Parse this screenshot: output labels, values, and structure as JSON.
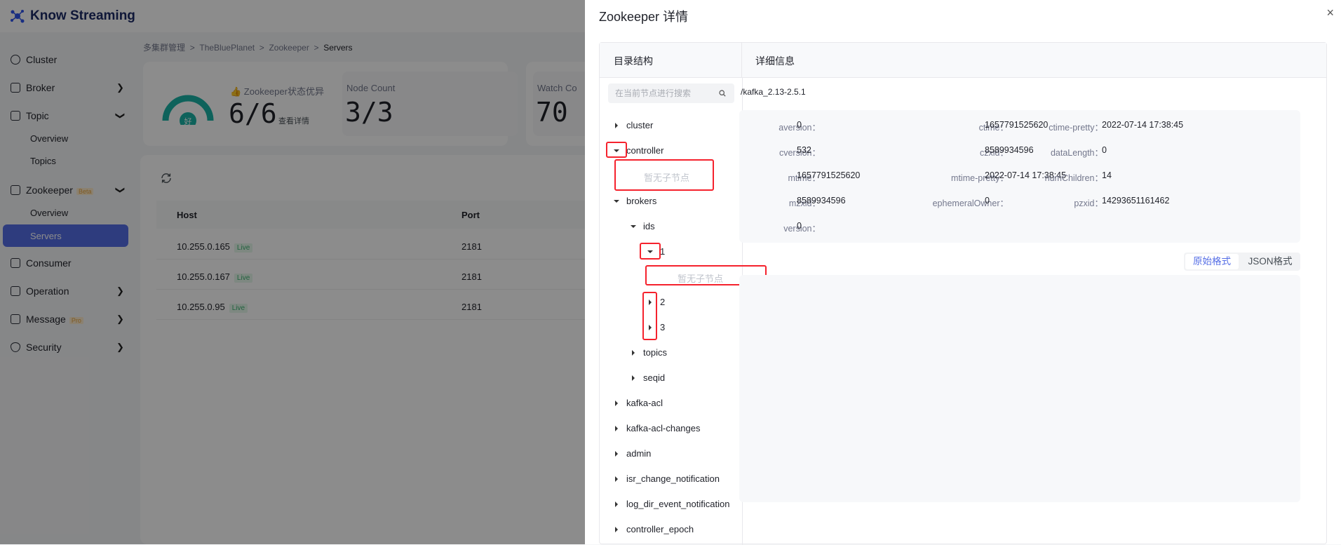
{
  "app": {
    "title": "Know Streaming"
  },
  "sidebar": {
    "items": [
      {
        "label": "Cluster"
      },
      {
        "label": "Broker"
      },
      {
        "label": "Topic"
      },
      {
        "label": "Overview"
      },
      {
        "label": "Topics"
      },
      {
        "label": "Zookeeper",
        "badge": "Beta"
      },
      {
        "label": "Overview"
      },
      {
        "label": "Servers"
      },
      {
        "label": "Consumer"
      },
      {
        "label": "Operation"
      },
      {
        "label": "Message",
        "badge": "Pro"
      },
      {
        "label": "Security"
      }
    ]
  },
  "breadcrumb": {
    "items": [
      "多集群管理",
      "TheBluePlanet",
      "Zookeeper"
    ],
    "sep": ">",
    "current": "Servers"
  },
  "stats": {
    "gauge_label": "好",
    "status_label": "👍 Zookeeper状态优异",
    "status_value": "6/6",
    "status_link": "查看详情",
    "node_count_label": "Node Count",
    "node_count_value": "3/3",
    "watch_label": "Watch Co",
    "watch_value": "70"
  },
  "table": {
    "columns": [
      "Host",
      "Port"
    ],
    "rows": [
      {
        "host": "10.255.0.165",
        "status": "Live",
        "port": "2181"
      },
      {
        "host": "10.255.0.167",
        "status": "Live",
        "port": "2181"
      },
      {
        "host": "10.255.0.95",
        "status": "Live",
        "port": "2181"
      }
    ]
  },
  "drawer": {
    "title": "Zookeeper 详情",
    "close": "×",
    "tree_header": "目录结构",
    "detail_header": "详细信息",
    "search_placeholder": "在当前节点进行搜索",
    "tree": {
      "cluster": "cluster",
      "controller": "controller",
      "empty1": "暂无子节点",
      "brokers": "brokers",
      "ids": "ids",
      "id1": "1",
      "empty2": "暂无子节点",
      "id2": "2",
      "id3": "3",
      "topics": "topics",
      "seqid": "seqid",
      "kafka_acl": "kafka-acl",
      "kafka_acl_changes": "kafka-acl-changes",
      "admin": "admin",
      "isr": "isr_change_notification",
      "logdir": "log_dir_event_notification",
      "controller_epoch": "controller_epoch"
    },
    "path": "/kafka_2.13-2.5.1",
    "fields": {
      "aversion_k": "aversion：",
      "aversion_v": "0",
      "ctime_k": "ctime：",
      "ctime_v": "1657791525620",
      "ctime_pretty_k": "ctime-pretty：",
      "ctime_pretty_v": "2022-07-14 17:38:45",
      "cversion_k": "cversion：",
      "cversion_v": "532",
      "czxid_k": "czxid：",
      "czxid_v": "8589934596",
      "datalength_k": "dataLength：",
      "datalength_v": "0",
      "mtime_k": "mtime：",
      "mtime_v": "1657791525620",
      "mtime_pretty_k": "mtime-pretty：",
      "mtime_pretty_v": "2022-07-14 17:38:45",
      "numchildren_k": "numChildren：",
      "numchildren_v": "14",
      "mzxid_k": "mzxid：",
      "mzxid_v": "8589934596",
      "ephemeral_k": "ephemeralOwner：",
      "ephemeral_v": "0",
      "pzxid_k": "pzxid：",
      "pzxid_v": "14293651161462",
      "version_k": "version：",
      "version_v": "0"
    },
    "tabs": {
      "raw": "原始格式",
      "json": "JSON格式"
    }
  },
  "colors": {
    "accent": "#556ee6",
    "highlight": "#f5222d"
  }
}
